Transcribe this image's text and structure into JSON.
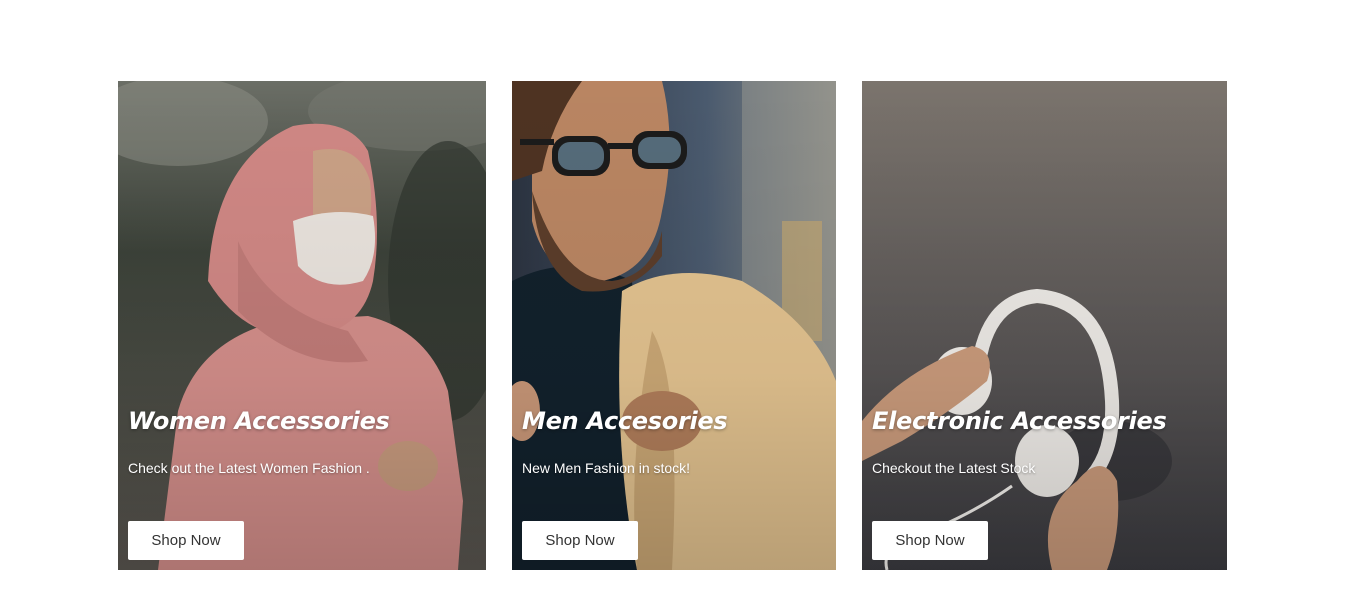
{
  "cards": [
    {
      "title": "Women Accessories",
      "description": "Check out the Latest Women Fashion .",
      "button": "Shop Now"
    },
    {
      "title": "Men Accesories",
      "description": "New Men Fashion in stock!",
      "button": "Shop Now"
    },
    {
      "title": "Electronic Accessories",
      "description": "Checkout the Latest Stock",
      "button": "Shop Now"
    }
  ],
  "colors": {
    "page_background": "#ffffff",
    "button_background": "#ffffff",
    "button_text": "#333333",
    "overlay_text": "#ffffff"
  }
}
